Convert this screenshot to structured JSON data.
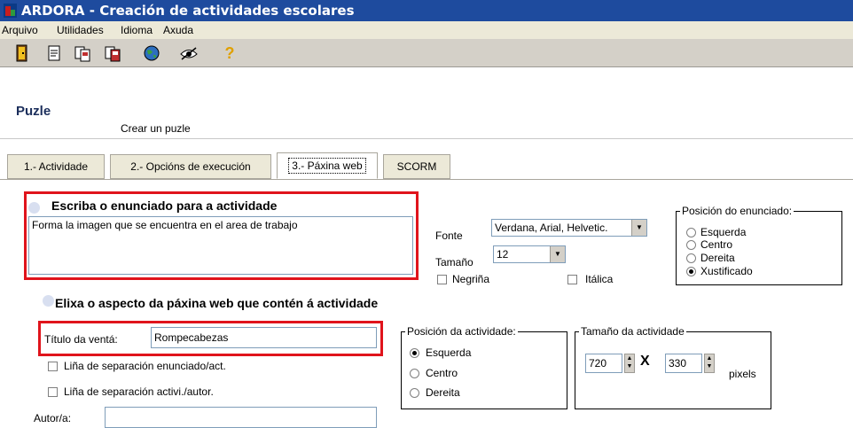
{
  "window": {
    "title": "ARDORA - Creación de actividades escolares"
  },
  "menu": [
    "Arquivo",
    "Utilidades",
    "Idioma",
    "Axuda"
  ],
  "toolbar": {
    "icons": [
      "exit-icon",
      "new-document-icon",
      "open-icon",
      "save-icon",
      "globe-icon",
      "preview-eye-icon",
      "help-icon"
    ],
    "help_glyph": "?"
  },
  "section": {
    "title": "Puzle",
    "subtitle": "Crear un puzle"
  },
  "tabs": [
    "1.- Actividade",
    "2.- Opcións de execución",
    "3.- Páxina web",
    "SCORM"
  ],
  "statement": {
    "heading": "Escriba o enunciado para a actividade",
    "value": "Forma la imagen que se encuentra en el area de trabajo"
  },
  "font": {
    "fonte_label": "Fonte",
    "fonte_value": "Verdana, Arial, Helvetic.",
    "size_label": "Tamaño",
    "size_value": "12",
    "bold_label": "Negriña",
    "italic_label": "Itálica"
  },
  "statement_position": {
    "legend": "Posición do enunciado:",
    "options": [
      "Esquerda",
      "Centro",
      "Dereita",
      "Xustificado"
    ],
    "selected": "Xustificado"
  },
  "appearance": {
    "heading": "Elixa o aspecto da páxina web que contén á actividade"
  },
  "window_title_field": {
    "label": "Título da ventá:",
    "value": "Rompecabezas"
  },
  "separators": {
    "statement_activity": "Liña de separación enunciado/act.",
    "activity_author": "Liña de separación activi./autor."
  },
  "author": {
    "label": "Autor/a:",
    "value": ""
  },
  "activity_position": {
    "legend": "Posición da actividade:",
    "options": [
      "Esquerda",
      "Centro",
      "Dereita"
    ],
    "selected": "Esquerda"
  },
  "activity_size": {
    "legend": "Tamaño da actividade",
    "width": "720",
    "height": "330",
    "times": "X",
    "unit": "pixels"
  },
  "colors": {
    "titlebar": "#1e4b9e",
    "highlight_border": "#e0141c",
    "section_title": "#1c2f5c"
  }
}
